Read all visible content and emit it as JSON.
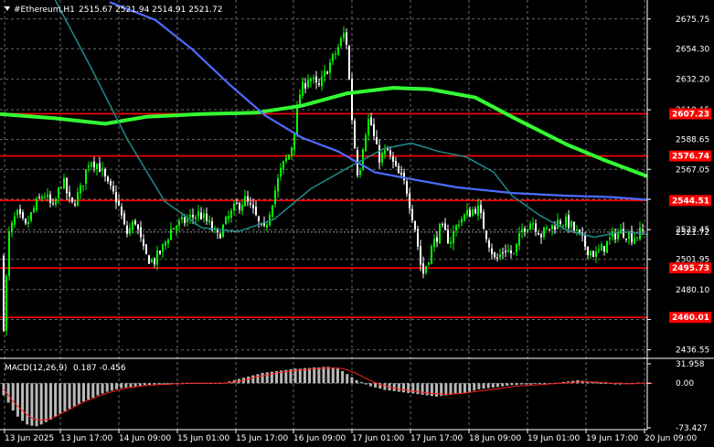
{
  "header": {
    "symbol": "#Ethereum,H1",
    "ohlc": "2515.67 2521.94 2514.91 2521.72"
  },
  "macd_header": {
    "label": "MACD(12,26,9)",
    "values": "0.187 -0.456"
  },
  "colors": {
    "background": "#000000",
    "bull_candle": "#00ff00",
    "bear_candle": "#ffffff",
    "grid": "#6b6b6b",
    "level_line": "#ff0000",
    "ma_slow": "#33ff33",
    "ma_mid": "#4f6cff",
    "ma_fast": "#1f8b8b",
    "macd_hist": "#b8b8b8",
    "macd_signal": "#ff2020"
  },
  "chart_data": [
    {
      "type": "candlestick",
      "title": "#Ethereum,H1",
      "x_tick_labels": [
        "13 Jun 2025",
        "13 Jun 17:00",
        "14 Jun 09:00",
        "15 Jun 01:00",
        "15 Jun 17:00",
        "16 Jun 09:00",
        "17 Jun 01:00",
        "17 Jun 17:00",
        "18 Jun 09:00",
        "19 Jun 01:00",
        "19 Jun 17:00",
        "20 Jun 09:00"
      ],
      "y_tick_labels": [
        2675.75,
        2654.3,
        2632.2,
        2610.15,
        2588.65,
        2567.05,
        2545.4,
        2523.45,
        2501.95,
        2480.1,
        2458.45,
        2436.55
      ],
      "ylim": [
        2430.4,
        2689.5
      ],
      "last_price": 2521.72,
      "levels": [
        2607.23,
        2576.74,
        2544.51,
        2495.73,
        2460.01
      ],
      "candle_path": [
        [
          0,
          2648
        ],
        [
          4,
          2455
        ],
        [
          10,
          2520
        ],
        [
          18,
          2535
        ],
        [
          28,
          2525
        ],
        [
          38,
          2540
        ],
        [
          48,
          2550
        ],
        [
          58,
          2538
        ],
        [
          68,
          2560
        ],
        [
          78,
          2540
        ],
        [
          88,
          2552
        ],
        [
          98,
          2575
        ],
        [
          108,
          2570
        ],
        [
          118,
          2555
        ],
        [
          128,
          2545
        ],
        [
          138,
          2520
        ],
        [
          148,
          2530
        ],
        [
          158,
          2505
        ],
        [
          168,
          2500
        ],
        [
          178,
          2510
        ],
        [
          188,
          2525
        ],
        [
          198,
          2528
        ],
        [
          208,
          2532
        ],
        [
          218,
          2535
        ],
        [
          228,
          2528
        ],
        [
          238,
          2518
        ],
        [
          248,
          2530
        ],
        [
          258,
          2540
        ],
        [
          268,
          2545
        ],
        [
          278,
          2535
        ],
        [
          288,
          2520
        ],
        [
          298,
          2545
        ],
        [
          308,
          2568
        ],
        [
          318,
          2580
        ],
        [
          328,
          2622
        ],
        [
          338,
          2635
        ],
        [
          348,
          2625
        ],
        [
          358,
          2640
        ],
        [
          368,
          2652
        ],
        [
          378,
          2668
        ],
        [
          386,
          2595
        ],
        [
          392,
          2560
        ],
        [
          398,
          2590
        ],
        [
          404,
          2605
        ],
        [
          414,
          2575
        ],
        [
          424,
          2580
        ],
        [
          434,
          2565
        ],
        [
          444,
          2555
        ],
        [
          454,
          2525
        ],
        [
          462,
          2490
        ],
        [
          472,
          2510
        ],
        [
          482,
          2525
        ],
        [
          492,
          2515
        ],
        [
          502,
          2530
        ],
        [
          512,
          2535
        ],
        [
          522,
          2540
        ],
        [
          532,
          2520
        ],
        [
          542,
          2500
        ],
        [
          552,
          2510
        ],
        [
          562,
          2505
        ],
        [
          572,
          2525
        ],
        [
          582,
          2530
        ],
        [
          592,
          2520
        ],
        [
          602,
          2525
        ],
        [
          612,
          2530
        ],
        [
          622,
          2528
        ],
        [
          632,
          2520
        ],
        [
          642,
          2510
        ],
        [
          652,
          2505
        ],
        [
          662,
          2512
        ],
        [
          672,
          2520
        ],
        [
          682,
          2522
        ],
        [
          692,
          2518
        ],
        [
          702,
          2521.72
        ]
      ],
      "moving_averages": [
        {
          "points": [
            [
              0,
              2607
            ],
            [
              60,
              2604
            ],
            [
              115,
              2600
            ],
            [
              160,
              2605
            ],
            [
              220,
              2607
            ],
            [
              280,
              2608
            ],
            [
              330,
              2613
            ],
            [
              380,
              2622
            ],
            [
              430,
              2626
            ],
            [
              470,
              2625
            ],
            [
              520,
              2619
            ],
            [
              560,
              2605
            ],
            [
              620,
              2585
            ],
            [
              660,
              2574
            ],
            [
              708,
              2562
            ]
          ]
        },
        {
          "points": [
            [
              120,
              2688
            ],
            [
              170,
              2675
            ],
            [
              210,
              2654
            ],
            [
              250,
              2629
            ],
            [
              290,
              2606
            ],
            [
              330,
              2590
            ],
            [
              370,
              2580
            ],
            [
              410,
              2565
            ],
            [
              450,
              2560
            ],
            [
              500,
              2554
            ],
            [
              560,
              2550
            ],
            [
              620,
              2548
            ],
            [
              670,
              2547
            ],
            [
              708,
              2545
            ]
          ]
        },
        {
          "points": [
            [
              60,
              2690
            ],
            [
              100,
              2640
            ],
            [
              140,
              2588
            ],
            [
              180,
              2544
            ],
            [
              220,
              2525
            ],
            [
              260,
              2522
            ],
            [
              300,
              2531
            ],
            [
              340,
              2553
            ],
            [
              380,
              2568
            ],
            [
              420,
              2582
            ],
            [
              450,
              2586
            ],
            [
              480,
              2580
            ],
            [
              510,
              2576
            ],
            [
              540,
              2565
            ],
            [
              560,
              2548
            ],
            [
              590,
              2534
            ],
            [
              620,
              2523
            ],
            [
              650,
              2518
            ],
            [
              680,
              2522
            ],
            [
              708,
              2520
            ]
          ]
        }
      ]
    },
    {
      "type": "histogram",
      "title": "MACD(12,26,9)",
      "y_tick_labels": [
        "31.958",
        "0.00",
        "-73.427"
      ],
      "ylim": [
        -73.427,
        31.958
      ],
      "values": [
        -20,
        -32,
        -45,
        -55,
        -62,
        -68,
        -70,
        -71,
        -68,
        -64,
        -60,
        -55,
        -50,
        -46,
        -42,
        -38,
        -34,
        -30,
        -27,
        -24,
        -20,
        -17,
        -14,
        -12,
        -10,
        -8,
        -7,
        -6,
        -5,
        -4,
        -3,
        -3,
        -2,
        -2,
        -2,
        -2,
        -1,
        -1,
        0,
        0,
        0,
        0,
        0,
        0,
        0,
        -1,
        0,
        1,
        3,
        5,
        7,
        9,
        11,
        13,
        15,
        17,
        18,
        19,
        20,
        21,
        22,
        23,
        24,
        24,
        25,
        25,
        26,
        26,
        27,
        27,
        26,
        24,
        20,
        15,
        10,
        5,
        2,
        -2,
        -5,
        -7,
        -9,
        -11,
        -12,
        -13,
        -14,
        -15,
        -16,
        -17,
        -18,
        -19,
        -20,
        -21,
        -22,
        -21,
        -20,
        -19,
        -18,
        -17,
        -16,
        -14,
        -12,
        -10,
        -9,
        -8,
        -7,
        -6,
        -5,
        -4,
        -3,
        -3,
        -2,
        -2,
        -2,
        -1,
        -1,
        -1,
        0,
        0,
        1,
        2,
        3,
        4,
        5,
        4,
        3,
        2,
        1,
        0,
        -1,
        -1,
        -2,
        -2,
        -1,
        0,
        0,
        1,
        1
      ],
      "signal": [
        -10,
        -20,
        -30,
        -38,
        -45,
        -52,
        -57,
        -60,
        -61,
        -60,
        -58,
        -55,
        -51,
        -47,
        -43,
        -39,
        -35,
        -31,
        -28,
        -25,
        -22,
        -19,
        -16,
        -14,
        -12,
        -10,
        -8,
        -7,
        -6,
        -5,
        -4,
        -3,
        -3,
        -2,
        -2,
        -2,
        -1,
        -1,
        -1,
        0,
        0,
        0,
        0,
        0,
        0,
        0,
        0,
        0,
        1,
        2,
        3,
        5,
        7,
        9,
        11,
        12,
        14,
        15,
        17,
        18,
        19,
        20,
        21,
        22,
        22,
        23,
        24,
        24,
        25,
        25,
        25,
        25,
        24,
        22,
        19,
        16,
        12,
        8,
        4,
        1,
        -2,
        -4,
        -6,
        -8,
        -10,
        -11,
        -12,
        -13,
        -14,
        -15,
        -16,
        -17,
        -17,
        -18,
        -18,
        -18,
        -17,
        -17,
        -16,
        -15,
        -14,
        -13,
        -12,
        -11,
        -10,
        -9,
        -8,
        -7,
        -6,
        -5,
        -4,
        -4,
        -3,
        -3,
        -2,
        -2,
        -1,
        -1,
        0,
        0,
        1,
        1,
        2,
        2,
        2,
        2,
        2,
        1,
        1,
        0,
        0,
        0,
        -1,
        -1,
        -1,
        0,
        0,
        0,
        0
      ]
    }
  ]
}
